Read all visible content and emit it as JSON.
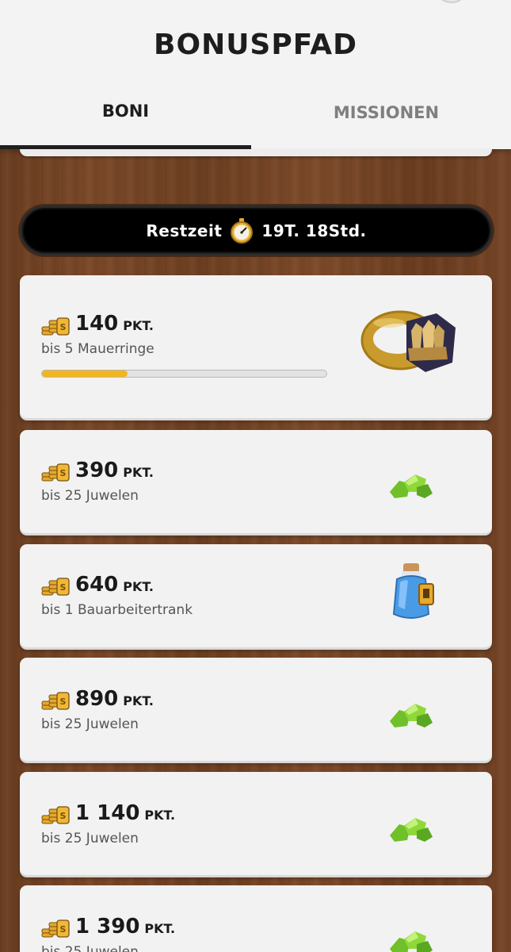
{
  "header": {
    "title": "BONUSPFAD",
    "tabs": [
      {
        "label": "BONI",
        "active": true
      },
      {
        "label": "MISSIONEN",
        "active": false
      }
    ]
  },
  "timer": {
    "label": "Restzeit",
    "value": "19T. 18Std.",
    "icon": "stopwatch-icon"
  },
  "colors": {
    "progress_fill": "#f2b51d",
    "card_bg": "#f2f2f2",
    "timer_bg": "#000000"
  },
  "rewards": [
    {
      "points": "140",
      "unit": "PKT.",
      "reward": "bis 5 Mauerringe",
      "icon": "wall-ring-icon",
      "progress": 0.3
    },
    {
      "points": "390",
      "unit": "PKT.",
      "reward": "bis 25 Juwelen",
      "icon": "gems-icon"
    },
    {
      "points": "640",
      "unit": "PKT.",
      "reward": "bis 1 Bauarbeitertrank",
      "icon": "builder-potion-icon"
    },
    {
      "points": "890",
      "unit": "PKT.",
      "reward": "bis 25 Juwelen",
      "icon": "gems-icon"
    },
    {
      "points": "1 140",
      "unit": "PKT.",
      "reward": "bis 25 Juwelen",
      "icon": "gems-icon"
    },
    {
      "points": "1 390",
      "unit": "PKT.",
      "reward": "bis 25 Juwelen",
      "icon": "gems-icon"
    }
  ]
}
